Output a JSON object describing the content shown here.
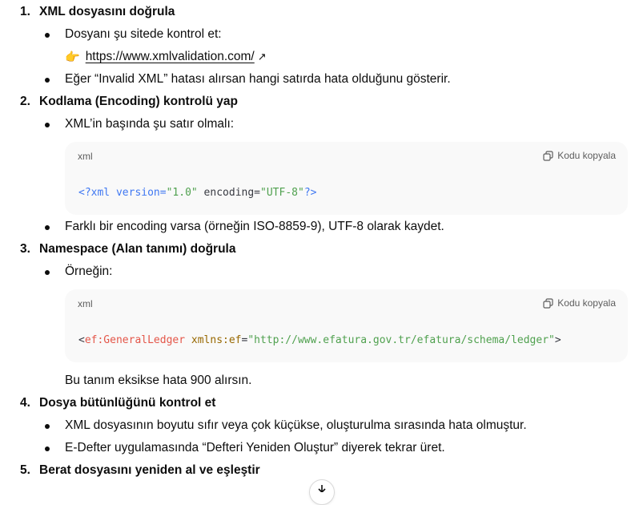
{
  "steps": [
    {
      "number": "1.",
      "title": "XML dosyasını doğrula",
      "bullet1": "Dosyanı şu sitede kontrol et:",
      "link_emoji": "👉",
      "link_text": "https://www.xmlvalidation.com/",
      "link_arrow": "↗",
      "bullet2": "Eğer “Invalid XML” hatası alırsan hangi satırda hata olduğunu gösterir."
    },
    {
      "number": "2.",
      "title": "Kodlama (Encoding) kontrolü yap",
      "bullet1": "XML’in başında şu satır olmalı:",
      "code": {
        "lang": "xml",
        "copy_label": "Kodu kopyala",
        "p1": "<?xml",
        "p2": " ",
        "p3": "version=",
        "p4": "\"1.0\"",
        "p5": " encoding=",
        "p6": "\"UTF-8\"",
        "p7": "?>"
      },
      "bullet2": "Farklı bir encoding varsa (örneğin ISO-8859-9), UTF-8 olarak kaydet."
    },
    {
      "number": "3.",
      "title": "Namespace (Alan tanımı) doğrula",
      "bullet1": "Örneğin:",
      "code": {
        "lang": "xml",
        "copy_label": "Kodu kopyala",
        "p1": "<",
        "p2": "ef:GeneralLedger",
        "p3": " ",
        "p4": "xmlns:ef",
        "p5": "=",
        "p6": "\"http://www.efatura.gov.tr/efatura/schema/ledger\"",
        "p7": ">"
      },
      "note": "Bu tanım eksikse hata 900 alırsın."
    },
    {
      "number": "4.",
      "title": "Dosya bütünlüğünü kontrol et",
      "bullet1": "XML dosyasının boyutu sıfır veya çok küçükse, oluşturulma sırasında hata olmuştur.",
      "bullet2": "E-Defter uygulamasında “Defteri Yeniden Oluştur” diyerek tekrar üret."
    },
    {
      "number": "5.",
      "title": "Berat dosyasını yeniden al ve eşleştir"
    }
  ],
  "icons": {
    "copy": "copy-icon",
    "hand": "pointing-hand-icon",
    "external": "external-link-icon",
    "scroll": "scroll-down-icon"
  }
}
